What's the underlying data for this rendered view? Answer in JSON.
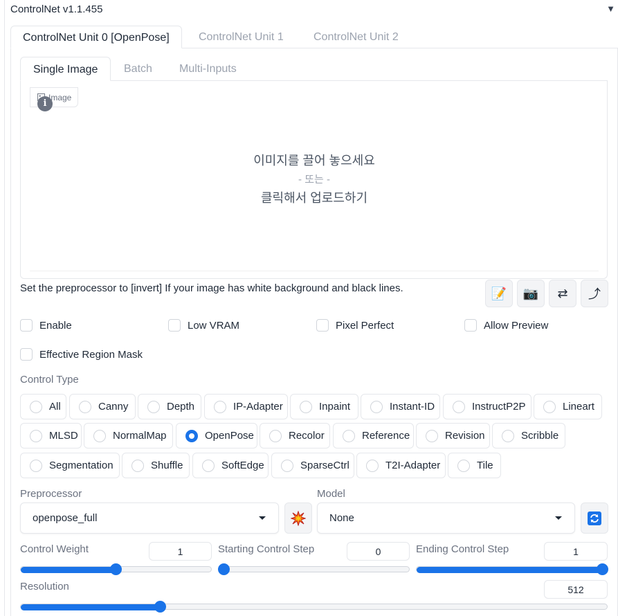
{
  "accordion": {
    "title": "ControlNet v1.1.455",
    "toggle_icon": "triangle-down-icon"
  },
  "unit_tabs": [
    {
      "label": "ControlNet Unit 0 [OpenPose]",
      "active": true
    },
    {
      "label": "ControlNet Unit 1",
      "active": false
    },
    {
      "label": "ControlNet Unit 2",
      "active": false
    }
  ],
  "image_tabs": [
    {
      "label": "Single Image",
      "active": true
    },
    {
      "label": "Batch",
      "active": false
    },
    {
      "label": "Multi-Inputs",
      "active": false
    }
  ],
  "image_area": {
    "label": "Image",
    "drop_line1": "이미지를 끌어 놓으세요",
    "drop_line2": "- 또는 -",
    "drop_line3": "클릭해서 업로드하기"
  },
  "hint": "Set the preprocessor to [invert] If your image has white background and black lines.",
  "tool_buttons": [
    {
      "name": "notepad-icon",
      "glyph": "📝"
    },
    {
      "name": "camera-icon",
      "glyph": "📷"
    },
    {
      "name": "swap-arrows-icon",
      "glyph": "⇄"
    },
    {
      "name": "curved-arrow-icon",
      "glyph": "⤴"
    }
  ],
  "options": {
    "enable": "Enable",
    "low_vram": "Low VRAM",
    "pixel_perfect": "Pixel Perfect",
    "allow_preview": "Allow Preview",
    "effective_region_mask": "Effective Region Mask"
  },
  "control_type": {
    "label": "Control Type",
    "selected": "OpenPose",
    "rows": [
      [
        "All",
        "Canny",
        "Depth",
        "IP-Adapter",
        "Inpaint",
        "Instant-ID",
        "InstructP2P",
        "Lineart"
      ],
      [
        "MLSD",
        "NormalMap",
        "OpenPose",
        "Recolor",
        "Reference",
        "Revision",
        "Scribble"
      ],
      [
        "Segmentation",
        "Shuffle",
        "SoftEdge",
        "SparseCtrl",
        "T2I-Adapter",
        "Tile"
      ]
    ]
  },
  "preprocessor": {
    "label": "Preprocessor",
    "value": "openpose_full",
    "run_icon": "explosion-icon"
  },
  "model": {
    "label": "Model",
    "value": "None",
    "refresh_icon": "refresh-icon"
  },
  "sliders": {
    "control_weight": {
      "label": "Control Weight",
      "value": "1",
      "fraction": 0.5
    },
    "starting_step": {
      "label": "Starting Control Step",
      "value": "0",
      "fraction": 0.0
    },
    "ending_step": {
      "label": "Ending Control Step",
      "value": "1",
      "fraction": 1.0
    },
    "resolution": {
      "label": "Resolution",
      "value": "512",
      "fraction": 0.233
    }
  },
  "colors": {
    "accent": "#1a73e8",
    "border": "#e5e7eb",
    "muted_text": "#9ca3af"
  }
}
